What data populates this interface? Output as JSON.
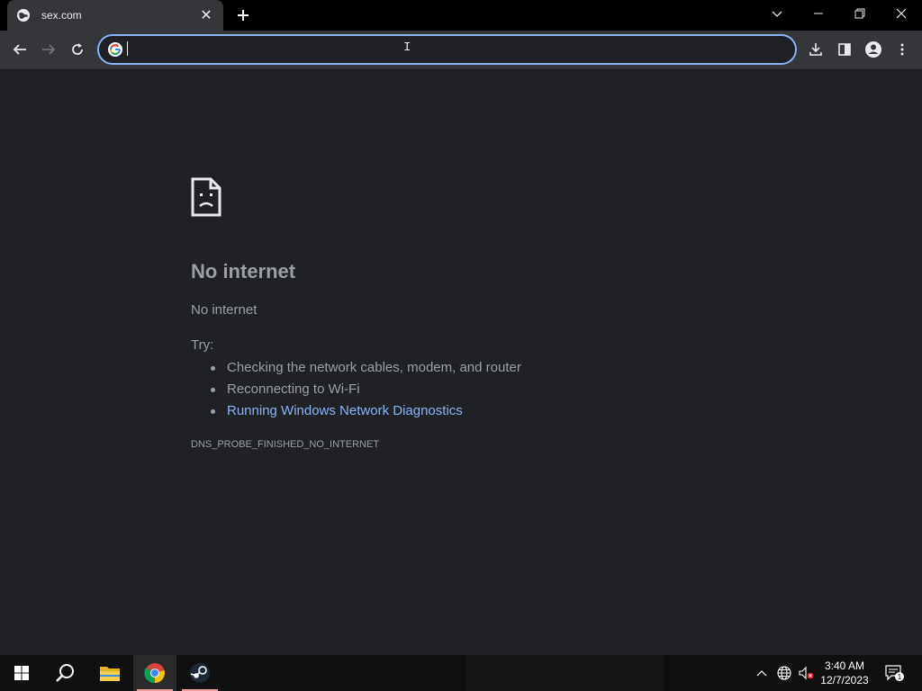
{
  "browser": {
    "tab": {
      "title": "sex.com",
      "favicon": "globe-icon"
    },
    "window_controls": [
      "chevron-down-icon",
      "minimize-icon",
      "restore-icon",
      "close-icon"
    ],
    "omnibox": {
      "value": "",
      "placeholder": ""
    },
    "accent": "#8ab4f8"
  },
  "error_page": {
    "icon": "sad-page-icon",
    "title": "No internet",
    "subtitle": "No internet",
    "try_label": "Try:",
    "suggestions": [
      "Checking the network cables, modem, and router",
      "Reconnecting to Wi-Fi",
      "Running Windows Network Diagnostics"
    ],
    "error_code": "DNS_PROBE_FINISHED_NO_INTERNET"
  },
  "taskbar": {
    "apps": [
      "windows-start-icon",
      "search-icon",
      "file-explorer-icon",
      "chrome-icon",
      "steam-icon"
    ],
    "clock": {
      "time": "3:40 AM",
      "date": "12/7/2023"
    },
    "notifications_count": "1"
  }
}
